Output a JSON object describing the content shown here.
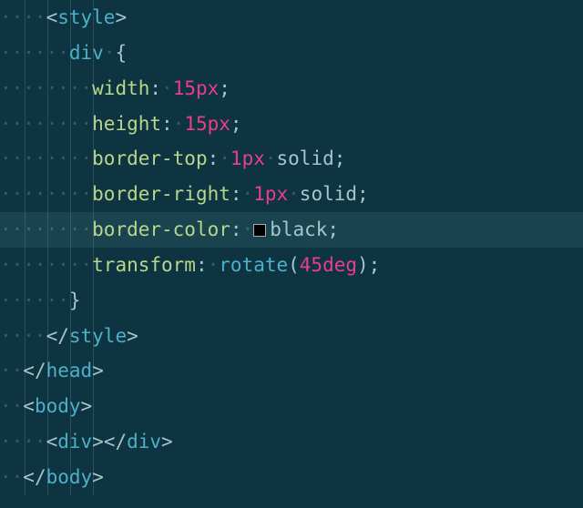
{
  "code": {
    "style_open": "style",
    "style_close": "style",
    "selector": "div",
    "brace_open": "{",
    "brace_close": "}",
    "props": {
      "width": {
        "name": "width",
        "num": "15",
        "unit": "px"
      },
      "height": {
        "name": "height",
        "num": "15",
        "unit": "px"
      },
      "border_top": {
        "name": "border-top",
        "num": "1",
        "unit": "px",
        "val": "solid"
      },
      "border_right": {
        "name": "border-right",
        "num": "1",
        "unit": "px",
        "val": "solid"
      },
      "border_color": {
        "name": "border-color",
        "val": "black"
      },
      "transform": {
        "name": "transform",
        "func": "rotate",
        "num": "45",
        "unit": "deg"
      }
    },
    "head_close": "head",
    "body_open": "body",
    "div_tag": "div",
    "body_close": "body"
  },
  "ws": {
    "dot": "·"
  }
}
